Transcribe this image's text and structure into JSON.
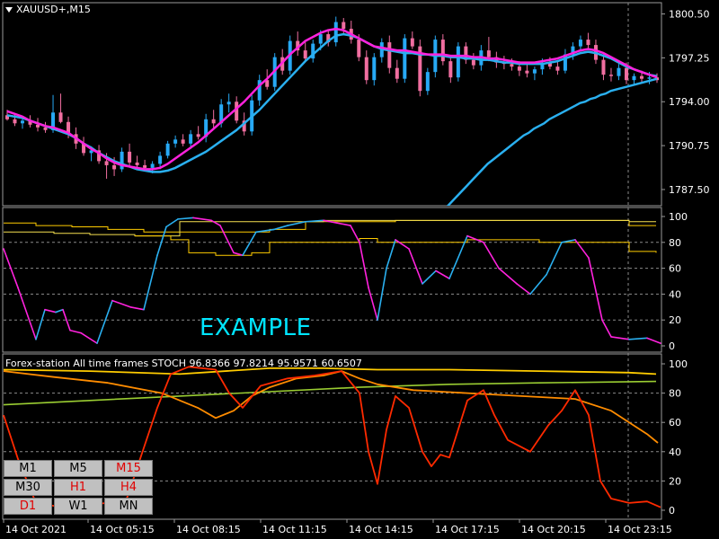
{
  "symbol": {
    "label": "XAUUSD+,M15"
  },
  "main_axis_labels": [
    "1800.50",
    "1797.25",
    "1794.00",
    "1790.75",
    "1787.50"
  ],
  "osc1_axis_labels": [
    "100",
    "80",
    "60",
    "40",
    "20",
    "0"
  ],
  "osc2_axis_labels": [
    "100",
    "80",
    "60",
    "40",
    "20",
    "0"
  ],
  "osc2_title": "Forex-station  All time frames STOCH 96.8366 97.8214 95.9571 60.6507",
  "watermark": "EXAMPLE",
  "time_labels": [
    "14 Oct 2021",
    "14 Oct 05:15",
    "14 Oct 08:15",
    "14 Oct 11:15",
    "14 Oct 14:15",
    "14 Oct 17:15",
    "14 Oct 20:15",
    "14 Oct 23:15"
  ],
  "timeframes": [
    {
      "label": "M1",
      "active": false
    },
    {
      "label": "M5",
      "active": false
    },
    {
      "label": "M15",
      "active": true
    },
    {
      "label": "M30",
      "active": false
    },
    {
      "label": "H1",
      "active": true
    },
    {
      "label": "H4",
      "active": true
    },
    {
      "label": "D1",
      "active": true
    },
    {
      "label": "W1",
      "active": false
    },
    {
      "label": "MN",
      "active": false
    }
  ],
  "colors": {
    "bull": "#27a9f5",
    "bear": "#f06ea0",
    "fast_ma": "#ff22dd",
    "slow_ma": "#2ab0f0",
    "grid": "#8a8a8a",
    "stoch_red": "#ff2a00",
    "stoch_orange": "#ff8c00",
    "stoch_yellow": "#ffcc00",
    "stoch_green": "#9acd32"
  },
  "chart_data": {
    "type": "candlestick",
    "price_axis": {
      "min": 1786.5,
      "max": 1801.0
    },
    "stoch_axis": {
      "min": 0,
      "max": 100,
      "levels": [
        20,
        40,
        60,
        80
      ]
    },
    "series": [
      {
        "name": "STOCH",
        "values": [
          96.8366,
          97.8214,
          95.9571,
          60.6507
        ]
      }
    ],
    "candles": [
      [
        1793.0,
        1793.4,
        1792.6,
        1792.7
      ],
      [
        1792.7,
        1793.1,
        1792.2,
        1792.4
      ],
      [
        1792.4,
        1792.9,
        1792.0,
        1792.6
      ],
      [
        1792.6,
        1793.0,
        1792.1,
        1792.3
      ],
      [
        1792.3,
        1792.8,
        1791.8,
        1792.1
      ],
      [
        1792.1,
        1792.5,
        1791.7,
        1791.9
      ],
      [
        1791.9,
        1794.5,
        1791.7,
        1793.2
      ],
      [
        1793.2,
        1794.6,
        1792.4,
        1792.5
      ],
      [
        1792.5,
        1792.9,
        1791.3,
        1791.6
      ],
      [
        1791.6,
        1792.1,
        1790.5,
        1790.9
      ],
      [
        1790.9,
        1791.4,
        1790.0,
        1790.2
      ],
      [
        1790.2,
        1790.7,
        1789.6,
        1790.4
      ],
      [
        1790.4,
        1790.8,
        1789.4,
        1789.6
      ],
      [
        1789.6,
        1790.2,
        1788.3,
        1789.3
      ],
      [
        1789.3,
        1789.9,
        1788.5,
        1789.0
      ],
      [
        1789.0,
        1790.6,
        1788.8,
        1790.3
      ],
      [
        1790.3,
        1790.9,
        1789.2,
        1789.5
      ],
      [
        1789.5,
        1790.0,
        1789.0,
        1789.3
      ],
      [
        1789.3,
        1789.7,
        1788.9,
        1789.1
      ],
      [
        1789.1,
        1789.6,
        1788.7,
        1789.4
      ],
      [
        1789.4,
        1790.3,
        1789.0,
        1790.0
      ],
      [
        1790.0,
        1791.1,
        1789.8,
        1790.9
      ],
      [
        1790.9,
        1791.5,
        1790.6,
        1791.2
      ],
      [
        1791.2,
        1791.6,
        1790.7,
        1790.9
      ],
      [
        1790.9,
        1791.9,
        1790.5,
        1791.6
      ],
      [
        1791.6,
        1792.2,
        1791.2,
        1791.4
      ],
      [
        1791.4,
        1793.1,
        1791.0,
        1792.7
      ],
      [
        1792.7,
        1793.4,
        1792.0,
        1792.4
      ],
      [
        1792.4,
        1794.2,
        1792.1,
        1793.8
      ],
      [
        1793.8,
        1794.6,
        1793.2,
        1794.0
      ],
      [
        1794.0,
        1794.4,
        1792.4,
        1792.6
      ],
      [
        1792.6,
        1793.2,
        1791.5,
        1791.8
      ],
      [
        1791.8,
        1794.5,
        1791.5,
        1794.1
      ],
      [
        1794.1,
        1796.0,
        1793.7,
        1795.6
      ],
      [
        1795.6,
        1796.4,
        1794.9,
        1795.1
      ],
      [
        1795.1,
        1797.6,
        1794.8,
        1797.3
      ],
      [
        1797.3,
        1797.9,
        1796.0,
        1796.3
      ],
      [
        1796.3,
        1798.9,
        1796.0,
        1798.5
      ],
      [
        1798.5,
        1799.2,
        1797.4,
        1797.8
      ],
      [
        1797.8,
        1798.4,
        1797.0,
        1797.2
      ],
      [
        1797.2,
        1798.6,
        1796.9,
        1798.3
      ],
      [
        1798.3,
        1799.3,
        1797.8,
        1799.0
      ],
      [
        1799.0,
        1799.3,
        1798.1,
        1798.4
      ],
      [
        1798.4,
        1800.3,
        1798.1,
        1799.9
      ],
      [
        1799.9,
        1800.2,
        1799.0,
        1799.4
      ],
      [
        1799.4,
        1800.0,
        1798.3,
        1798.6
      ],
      [
        1798.6,
        1799.0,
        1797.0,
        1797.3
      ],
      [
        1797.3,
        1797.8,
        1795.3,
        1795.6
      ],
      [
        1795.6,
        1797.6,
        1795.2,
        1797.3
      ],
      [
        1797.3,
        1798.7,
        1796.9,
        1798.4
      ],
      [
        1798.4,
        1798.9,
        1796.1,
        1796.5
      ],
      [
        1796.5,
        1797.1,
        1795.4,
        1795.7
      ],
      [
        1795.7,
        1799.0,
        1795.4,
        1798.7
      ],
      [
        1798.7,
        1799.2,
        1797.9,
        1798.1
      ],
      [
        1798.1,
        1798.6,
        1794.4,
        1794.8
      ],
      [
        1794.8,
        1796.5,
        1794.5,
        1796.2
      ],
      [
        1796.2,
        1798.9,
        1795.8,
        1798.6
      ],
      [
        1798.6,
        1799.0,
        1796.7,
        1797.0
      ],
      [
        1797.0,
        1797.4,
        1795.4,
        1795.8
      ],
      [
        1795.8,
        1798.4,
        1795.5,
        1798.1
      ],
      [
        1798.1,
        1798.4,
        1796.8,
        1797.1
      ],
      [
        1797.1,
        1797.6,
        1796.4,
        1796.7
      ],
      [
        1796.7,
        1798.2,
        1796.3,
        1797.8
      ],
      [
        1797.8,
        1798.8,
        1797.0,
        1797.3
      ],
      [
        1797.3,
        1797.7,
        1796.5,
        1796.9
      ],
      [
        1796.9,
        1797.4,
        1796.4,
        1796.8
      ],
      [
        1796.8,
        1797.2,
        1796.3,
        1796.6
      ],
      [
        1796.6,
        1797.0,
        1795.9,
        1796.3
      ],
      [
        1796.3,
        1796.8,
        1795.8,
        1796.1
      ],
      [
        1796.1,
        1796.6,
        1795.6,
        1796.4
      ],
      [
        1796.4,
        1797.2,
        1796.0,
        1796.9
      ],
      [
        1796.9,
        1797.3,
        1796.4,
        1796.6
      ],
      [
        1796.6,
        1797.0,
        1796.0,
        1796.3
      ],
      [
        1796.3,
        1797.9,
        1796.1,
        1797.5
      ],
      [
        1797.5,
        1798.4,
        1797.1,
        1798.1
      ],
      [
        1798.1,
        1798.9,
        1797.7,
        1798.6
      ],
      [
        1798.6,
        1799.1,
        1797.9,
        1798.2
      ],
      [
        1798.2,
        1798.6,
        1796.8,
        1797.1
      ],
      [
        1797.1,
        1797.5,
        1795.6,
        1796.0
      ],
      [
        1796.0,
        1796.5,
        1795.5,
        1795.9
      ],
      [
        1795.9,
        1796.8,
        1795.6,
        1796.5
      ],
      [
        1796.5,
        1796.9,
        1795.3,
        1795.6
      ],
      [
        1795.6,
        1796.1,
        1795.2,
        1795.9
      ],
      [
        1795.9,
        1796.3,
        1795.4,
        1795.7
      ],
      [
        1795.7,
        1796.2,
        1795.3,
        1795.8
      ],
      [
        1795.8,
        1796.1,
        1795.4,
        1795.6
      ]
    ],
    "fast_ma": [
      1793.3,
      1793.1,
      1792.9,
      1792.6,
      1792.4,
      1792.2,
      1792.1,
      1791.9,
      1791.7,
      1791.3,
      1790.9,
      1790.5,
      1790.2,
      1789.8,
      1789.5,
      1789.3,
      1789.2,
      1789.1,
      1789.0,
      1789.0,
      1789.1,
      1789.4,
      1789.8,
      1790.2,
      1790.6,
      1791.0,
      1791.5,
      1792.0,
      1792.5,
      1793.0,
      1793.5,
      1794.0,
      1794.6,
      1795.2,
      1795.7,
      1796.3,
      1796.9,
      1797.5,
      1798.0,
      1798.5,
      1798.8,
      1799.1,
      1799.3,
      1799.4,
      1799.3,
      1799.0,
      1798.7,
      1798.4,
      1798.1,
      1798.0,
      1797.9,
      1797.8,
      1797.8,
      1797.7,
      1797.6,
      1797.5,
      1797.5,
      1797.5,
      1797.4,
      1797.4,
      1797.4,
      1797.3,
      1797.3,
      1797.2,
      1797.2,
      1797.1,
      1797.0,
      1796.9,
      1796.9,
      1796.9,
      1797.0,
      1797.1,
      1797.2,
      1797.4,
      1797.6,
      1797.8,
      1797.9,
      1797.8,
      1797.6,
      1797.3,
      1797.0,
      1796.7,
      1796.4,
      1796.2,
      1796.0,
      1795.8
    ],
    "slow_ma": [
      1793.0,
      1792.9,
      1792.8,
      1792.6,
      1792.4,
      1792.2,
      1792.0,
      1791.8,
      1791.6,
      1791.3,
      1790.9,
      1790.6,
      1790.2,
      1789.9,
      1789.6,
      1789.4,
      1789.2,
      1789.0,
      1788.9,
      1788.8,
      1788.8,
      1788.9,
      1789.1,
      1789.4,
      1789.7,
      1790.0,
      1790.3,
      1790.7,
      1791.1,
      1791.5,
      1791.9,
      1792.4,
      1792.9,
      1793.4,
      1794.0,
      1794.6,
      1795.2,
      1795.8,
      1796.4,
      1797.0,
      1797.5,
      1798.0,
      1798.5,
      1798.9,
      1799.0,
      1798.9,
      1798.7,
      1798.4,
      1798.1,
      1797.9,
      1797.8,
      1797.7,
      1797.6,
      1797.6,
      1797.5,
      1797.5,
      1797.4,
      1797.4,
      1797.3,
      1797.3,
      1797.2,
      1797.2,
      1797.1,
      1797.1,
      1797.0,
      1796.9,
      1796.9,
      1796.8,
      1796.8,
      1796.8,
      1796.8,
      1796.9,
      1797.0,
      1797.2,
      1797.4,
      1797.6,
      1797.7,
      1797.6,
      1797.4,
      1797.2,
      1796.9,
      1796.6,
      1796.4,
      1796.2,
      1796.0,
      1795.9
    ],
    "long_ma": [
      1778.0,
      1778.1,
      1778.2,
      1778.4,
      1778.6,
      1778.9,
      1779.2,
      1779.5,
      1779.8,
      1780.2,
      1780.6,
      1781.0,
      1781.4,
      1781.8,
      1782.2,
      1782.6,
      1783.0,
      1783.4,
      1783.8,
      1784.2,
      1784.6,
      1785.0,
      1785.4,
      1785.8,
      1786.2,
      1786.6,
      1787.0,
      1787.4,
      1787.8,
      1788.2,
      1788.6,
      1789.0,
      1789.4,
      1789.7,
      1790.0,
      1790.3,
      1790.6,
      1790.9,
      1791.2,
      1791.5,
      1791.7,
      1792.0,
      1792.2,
      1792.4,
      1792.7,
      1792.9,
      1793.1,
      1793.3,
      1793.5,
      1793.7,
      1793.9,
      1794.0,
      1794.2,
      1794.3,
      1794.5,
      1794.6,
      1794.8,
      1794.9,
      1795.0,
      1795.1,
      1795.2,
      1795.3,
      1795.4,
      1795.5,
      1795.6,
      1795.7
    ]
  }
}
